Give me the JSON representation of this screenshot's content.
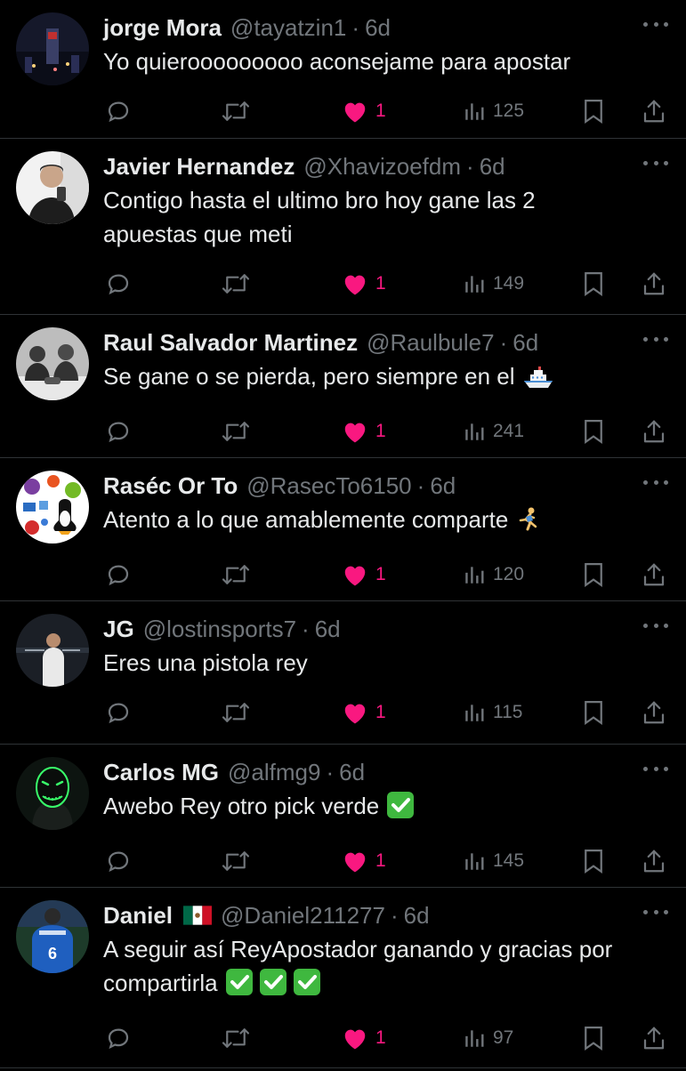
{
  "colors": {
    "background": "#000000",
    "text": "#e7e9ea",
    "muted": "#71767b",
    "like": "#f91880",
    "divider": "#2f3336"
  },
  "tweets": [
    {
      "name": "jorge Mora",
      "handle": "@tayatzin1",
      "time": "6d",
      "text": "Yo quierooooooooo aconsejame para apostar",
      "likes": "1",
      "views": "125",
      "avatar": "city-night-avatar"
    },
    {
      "name": "Javier Hernandez",
      "handle": "@Xhavizoefdm",
      "time": "6d",
      "text": "Contigo hasta el ultimo bro hoy gane las 2 apuestas que meti",
      "likes": "1",
      "views": "149",
      "avatar": "mirror-selfie-avatar"
    },
    {
      "name": "Raul Salvador Martinez",
      "handle": "@Raulbule7",
      "time": "6d",
      "text": "Se gane o se pierda, pero siempre en el",
      "text_emoji": "ship-emoji",
      "likes": "1",
      "views": "241",
      "avatar": "group-photo-avatar"
    },
    {
      "name": "Raséc Or To",
      "handle": "@RasecTo6150",
      "time": "6d",
      "text": "Atento a lo que amablemente comparte",
      "text_emoji": "runner-emoji",
      "likes": "1",
      "views": "120",
      "avatar": "linux-logos-avatar"
    },
    {
      "name": "JG",
      "handle": "@lostinsports7",
      "time": "6d",
      "text": "Eres una pistola rey",
      "likes": "1",
      "views": "115",
      "avatar": "footballer-avatar"
    },
    {
      "name": "Carlos MG",
      "handle": "@alfmg9",
      "time": "6d",
      "text": "Awebo Rey otro pick verde",
      "text_emoji": "check-emoji",
      "likes": "1",
      "views": "145",
      "avatar": "neon-mask-avatar"
    },
    {
      "name": "Daniel",
      "name_flag": "mexico-flag",
      "handle": "@Daniel211277",
      "time": "6d",
      "text": "A seguir así ReyApostador ganando y gracias por compartirla",
      "text_emoji": "triple-check-emoji",
      "likes": "1",
      "views": "97",
      "avatar": "jersey-avatar"
    }
  ]
}
